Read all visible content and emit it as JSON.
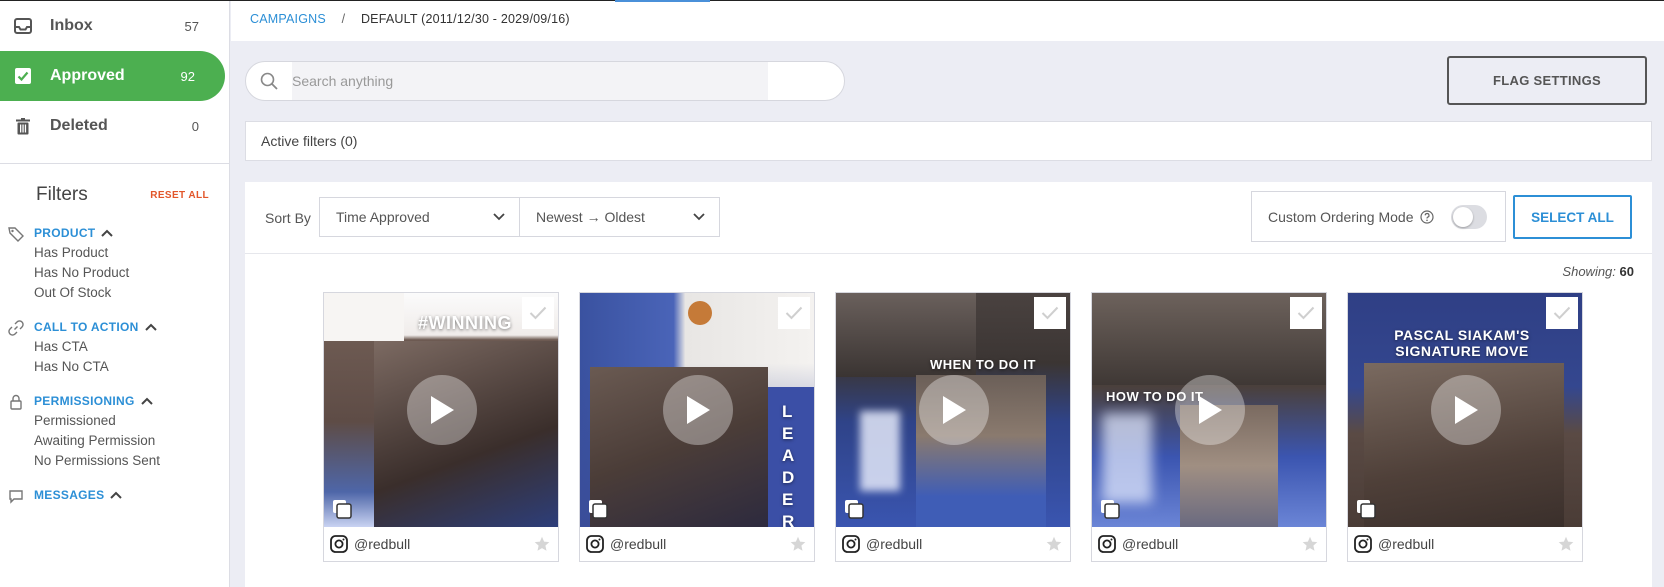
{
  "sidebar": {
    "nav": [
      {
        "label": "Inbox",
        "count": "57",
        "icon": "inbox-icon"
      },
      {
        "label": "Approved",
        "count": "92",
        "icon": "checkbox-icon"
      },
      {
        "label": "Deleted",
        "count": "0",
        "icon": "trash-icon"
      }
    ],
    "filters_title": "Filters",
    "reset_all": "RESET ALL",
    "groups": [
      {
        "title": "PRODUCT",
        "icon": "tag-icon",
        "items": [
          "Has Product",
          "Has No Product",
          "Out Of Stock"
        ]
      },
      {
        "title": "CALL TO ACTION",
        "icon": "link-icon",
        "items": [
          "Has CTA",
          "Has No CTA"
        ]
      },
      {
        "title": "PERMISSIONING",
        "icon": "lock-icon",
        "items": [
          "Permissioned",
          "Awaiting Permission",
          "No Permissions Sent"
        ]
      },
      {
        "title": "MESSAGES",
        "icon": "message-icon",
        "items": []
      }
    ]
  },
  "breadcrumb": {
    "root": "CAMPAIGNS",
    "separator": "/",
    "current": "DEFAULT (2011/12/30 - 2029/09/16)"
  },
  "search": {
    "placeholder": "Search anything",
    "value": ""
  },
  "flag_settings_label": "FLAG SETTINGS",
  "active_filters": "Active filters (0)",
  "toolbar": {
    "sort_by_label": "Sort By",
    "sort_field": "Time Approved",
    "sort_order": "Newest → Oldest",
    "custom_ordering_label": "Custom Ordering Mode",
    "custom_ordering_enabled": false,
    "select_all_label": "SELECT ALL"
  },
  "showing": {
    "label": "Showing:",
    "count": "60"
  },
  "cards": [
    {
      "handle": "@redbull",
      "overlay": "#WINNING"
    },
    {
      "handle": "@redbull",
      "overlay": "LEADER"
    },
    {
      "handle": "@redbull",
      "overlay": "WHEN TO DO IT"
    },
    {
      "handle": "@redbull",
      "overlay": "HOW TO DO IT"
    },
    {
      "handle": "@redbull",
      "overlay": "PASCAL SIAKAM'S SIGNATURE MOVE"
    }
  ],
  "colors": {
    "accent_green": "#4caf50",
    "link_blue": "#2c8fd6",
    "reset_orange": "#e2562a"
  }
}
